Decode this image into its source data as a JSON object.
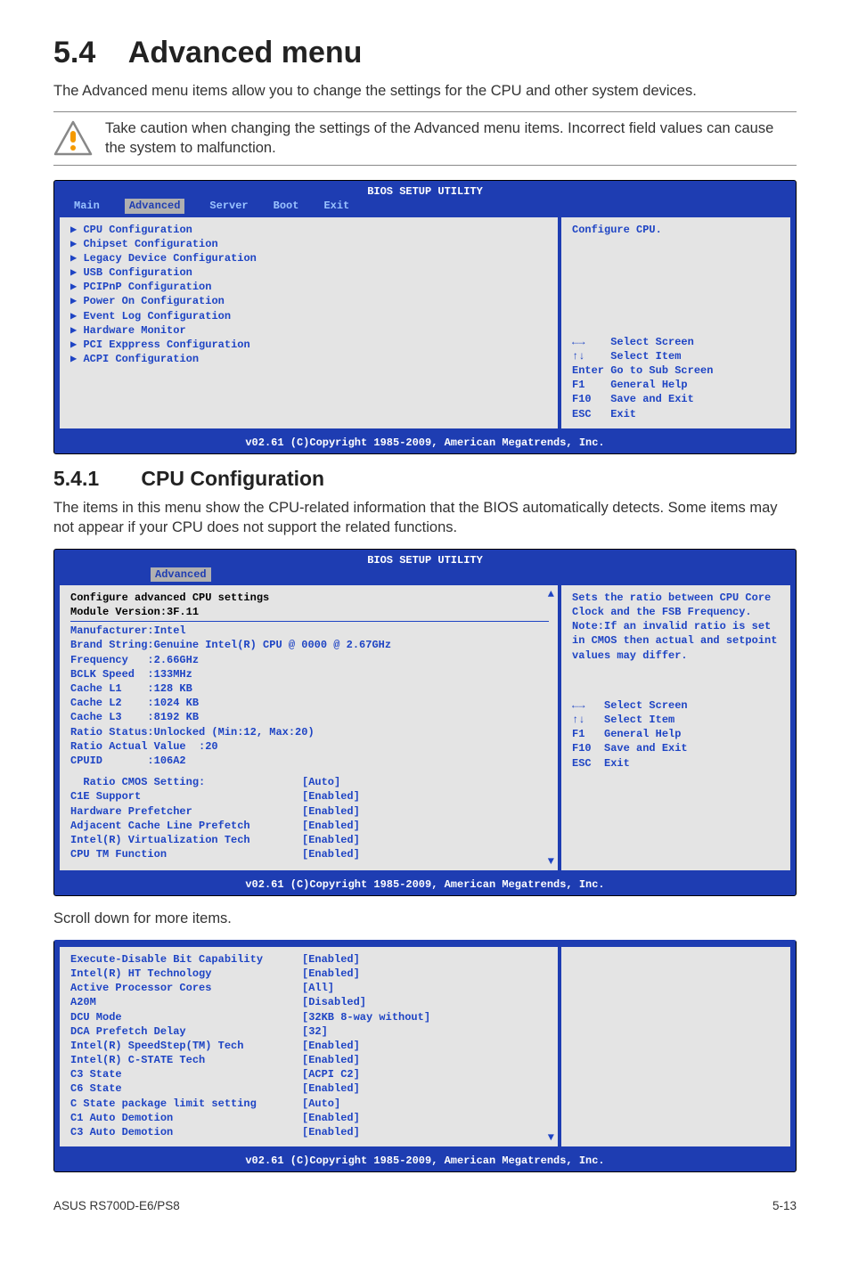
{
  "section": {
    "num": "5.4",
    "title": "Advanced menu"
  },
  "intro_text": "The Advanced menu items allow you to change the settings for the CPU and other system devices.",
  "caution_text": "Take caution when changing the settings of the Advanced menu items. Incorrect field values can cause the system to malfunction.",
  "subsection": {
    "num": "5.4.1",
    "title": "CPU Configuration"
  },
  "sub_intro_text": "The items in this menu show the CPU-related information that the BIOS automatically detects. Some items may not appear if your CPU does not support the related functions.",
  "scroll_text": "Scroll down for more items.",
  "footer_left": "ASUS RS700D-E6/PS8",
  "footer_right": "5-13",
  "bios_title": "BIOS SETUP UTILITY",
  "bios_copyright": "v02.61 (C)Copyright 1985-2009, American Megatrends, Inc.",
  "bios1": {
    "tabs": [
      "Main",
      "Advanced",
      "Server",
      "Boot",
      "Exit"
    ],
    "active_tab": "Advanced",
    "left_items": [
      "CPU Configuration",
      "Chipset Configuration",
      "Legacy Device Configuration",
      "USB Configuration",
      "PCIPnP Configuration",
      "Power On Configuration",
      "Event Log Configuration",
      "Hardware Monitor",
      "PCI Exppress Configuration",
      "ACPI Configuration"
    ],
    "help_top": "Configure CPU.",
    "help_keys": [
      "←→    Select Screen",
      "↑↓    Select Item",
      "Enter Go to Sub Screen",
      "F1    General Help",
      "F10   Save and Exit",
      "ESC   Exit"
    ]
  },
  "bios2": {
    "active_tab": "Advanced",
    "header_lines": [
      "Configure advanced CPU settings",
      "Module Version:3F.11"
    ],
    "info_lines": [
      "Manufacturer:Intel",
      "Brand String:Genuine Intel(R) CPU @ 0000 @ 2.67GHz",
      "Frequency   :2.66GHz",
      "BCLK Speed  :133MHz",
      "Cache L1    :128 KB",
      "Cache L2    :1024 KB",
      "Cache L3    :8192 KB",
      "Ratio Status:Unlocked (Min:12, Max:20)",
      "Ratio Actual Value  :20",
      "CPUID       :106A2"
    ],
    "options": [
      {
        "label": "  Ratio CMOS Setting:",
        "value": "[Auto]"
      },
      {
        "label": "C1E Support",
        "value": "[Enabled]"
      },
      {
        "label": "Hardware Prefetcher",
        "value": "[Enabled]"
      },
      {
        "label": "Adjacent Cache Line Prefetch",
        "value": "[Enabled]"
      },
      {
        "label": "Intel(R) Virtualization Tech",
        "value": "[Enabled]"
      },
      {
        "label": "CPU TM Function",
        "value": "[Enabled]"
      }
    ],
    "help_top": "Sets the ratio between CPU Core Clock and the FSB Frequency.\nNote:If an invalid ratio is set in CMOS then actual and setpoint values may differ.",
    "help_keys": [
      "←→   Select Screen",
      "↑↓   Select Item",
      "F1   General Help",
      "F10  Save and Exit",
      "ESC  Exit"
    ]
  },
  "bios3": {
    "options": [
      {
        "label": "Execute-Disable Bit Capability",
        "value": "[Enabled]"
      },
      {
        "label": "Intel(R) HT Technology",
        "value": "[Enabled]"
      },
      {
        "label": "Active Processor Cores",
        "value": "[All]"
      },
      {
        "label": "A20M",
        "value": "[Disabled]"
      },
      {
        "label": "DCU Mode",
        "value": "[32KB 8-way without]"
      },
      {
        "label": "DCA Prefetch Delay",
        "value": "[32]"
      },
      {
        "label": "Intel(R) SpeedStep(TM) Tech",
        "value": "[Enabled]"
      },
      {
        "label": "Intel(R) C-STATE Tech",
        "value": "[Enabled]"
      },
      {
        "label": "C3 State",
        "value": "[ACPI C2]"
      },
      {
        "label": "C6 State",
        "value": "[Enabled]"
      },
      {
        "label": "C State package limit setting",
        "value": "[Auto]"
      },
      {
        "label": "C1 Auto Demotion",
        "value": "[Enabled]"
      },
      {
        "label": "C3 Auto Demotion",
        "value": "[Enabled]"
      }
    ]
  }
}
